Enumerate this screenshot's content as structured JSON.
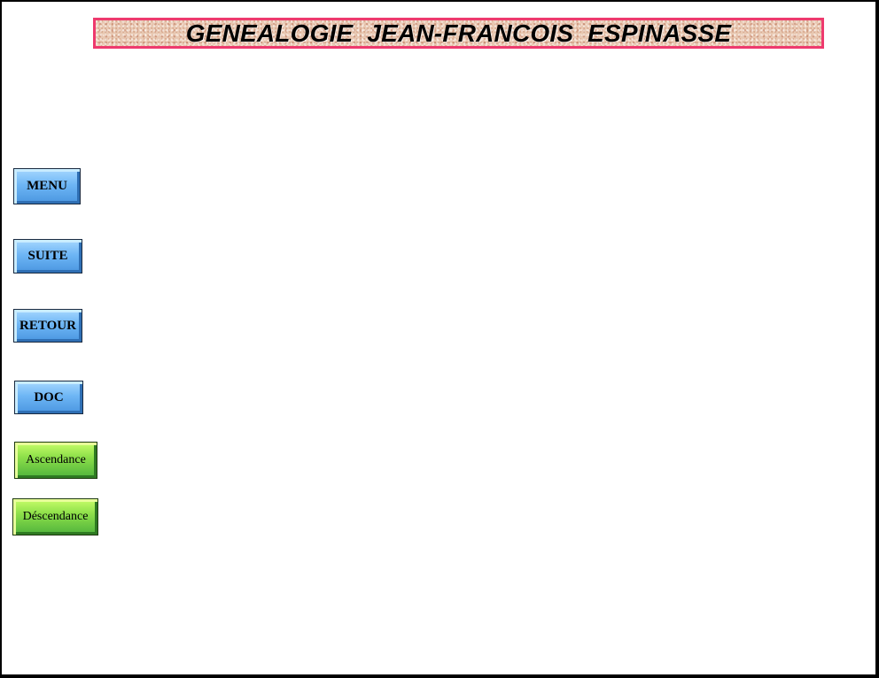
{
  "header": {
    "title": "GENEALOGIE  JEAN-FRANCOIS  ESPINASSE"
  },
  "nav": {
    "menu_label": "MENU",
    "suite_label": "SUITE",
    "retour_label": "RETOUR",
    "doc_label": "DOC",
    "ascendance_label": "Ascendance",
    "descendance_label": "Déscendance"
  },
  "colors": {
    "banner_border": "#ee3a6e",
    "banner_fill": "#e8c8b2",
    "nav_button_blue": "#6eb6f5",
    "nav_button_green": "#8ee04a"
  }
}
